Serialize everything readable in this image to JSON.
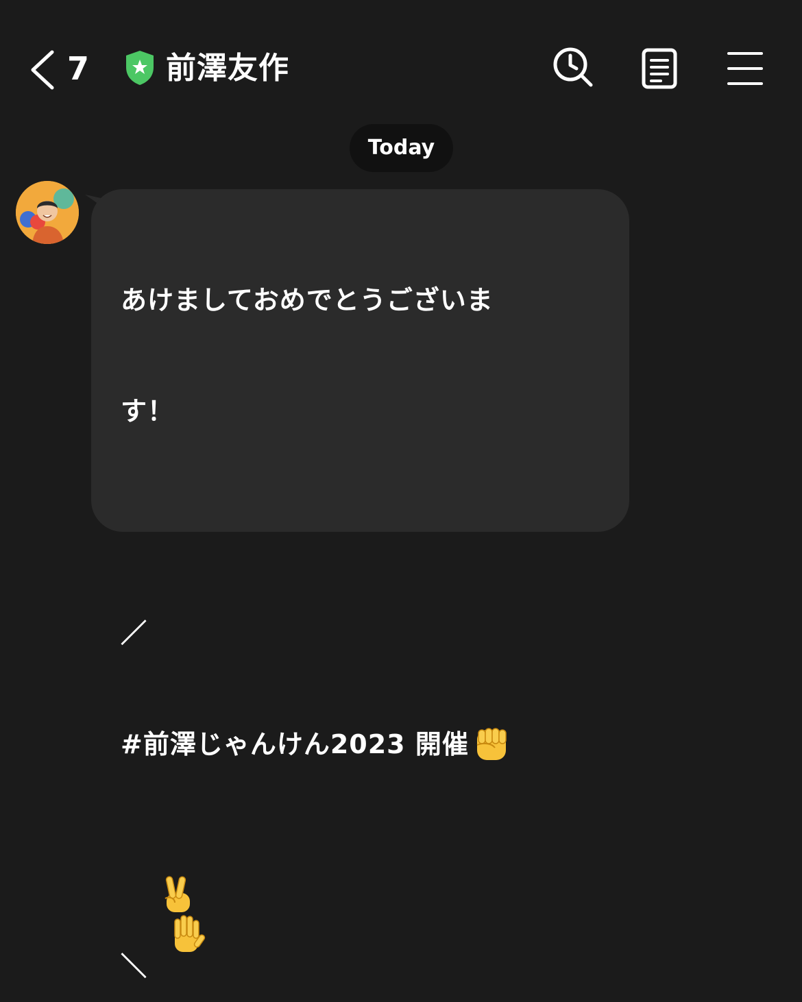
{
  "header": {
    "unread_count": "7",
    "chat_title": "前澤友作",
    "verified_color": "#4cc764"
  },
  "date_divider": "Today",
  "message": {
    "line1": "あけましておめでとうございま",
    "line2": "す！",
    "line3": "",
    "line4": "／",
    "line5": "#前澤じゃんけん2023 開催",
    "line6": "",
    "line7": "＼",
    "emojis": [
      "raised-fist",
      "victory-hand",
      "raised-hand"
    ]
  },
  "icons": [
    "back-chevron-icon",
    "verified-shield-icon",
    "search-history-icon",
    "notes-icon",
    "menu-icon"
  ]
}
